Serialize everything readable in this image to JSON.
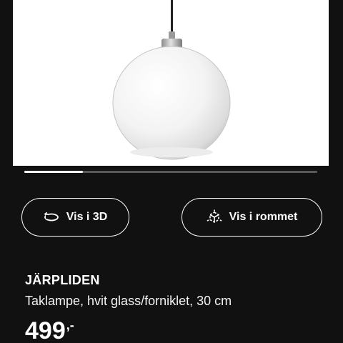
{
  "product": {
    "image_icon": "pendant-lamp-image",
    "gallery_progress": 0.2,
    "name": "JÄRPLIDEN",
    "description": "Taklampe, hvit glass/forniklet, 30 cm",
    "price": "499",
    "price_suffix": ",-"
  },
  "actions": {
    "view_3d_label": "Vis i 3D",
    "view_3d_icon": "rotate-3d-icon",
    "view_room_label": "Vis i rommet",
    "view_room_icon": "augmented-reality-icon"
  },
  "colors": {
    "background": "#111111",
    "image_background": "#ffffff",
    "text": "#ffffff",
    "progress_track": "#5a5a5a"
  }
}
